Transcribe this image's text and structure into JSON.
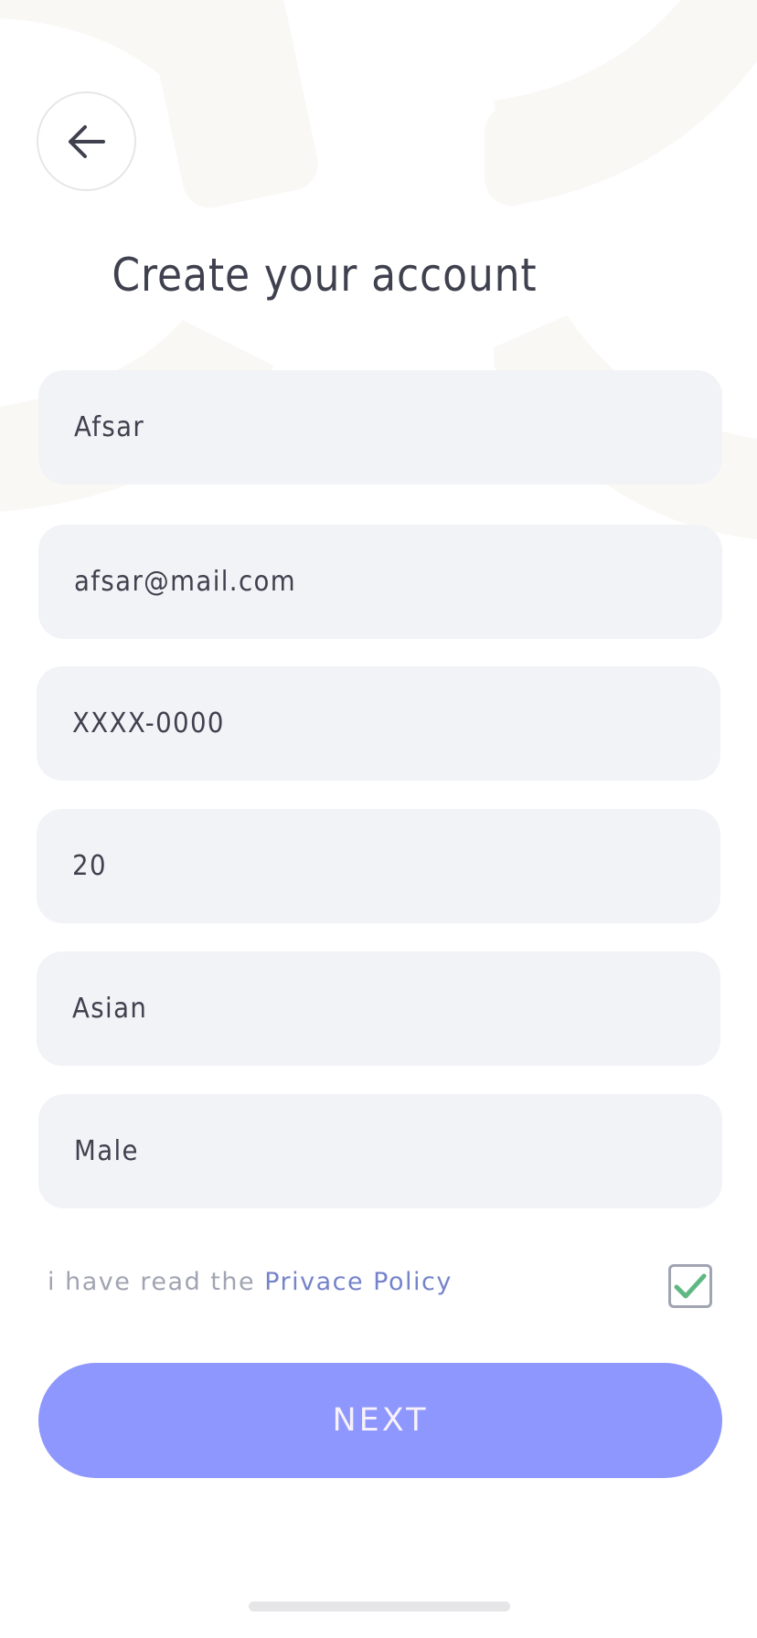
{
  "header": {
    "back_icon": "arrow-left-icon",
    "title": "Create your account"
  },
  "form": {
    "name_value": "Afsar",
    "email_value": "afsar@mail.com",
    "phone_value": "XXXX-0000",
    "age_value": "20",
    "ethnicity_value": "Asian",
    "gender_value": "Male"
  },
  "consent": {
    "prefix": "i have read the ",
    "link_label": "Privace Policy",
    "checked": true,
    "check_icon": "checkmark-icon",
    "check_color": "#5fb883"
  },
  "actions": {
    "next_label": "NEXT"
  },
  "colors": {
    "accent": "#8e97fd",
    "field_bg": "#f2f3f7",
    "text": "#3f414e",
    "muted": "#a1a4b2",
    "link": "#7583ca"
  }
}
